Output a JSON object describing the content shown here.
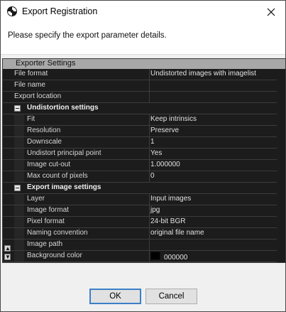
{
  "window": {
    "title": "Export Registration"
  },
  "prompt": "Please specify the export parameter details.",
  "grid": {
    "header": "Exporter Settings",
    "top_rows": [
      {
        "label": "File format",
        "value": "Undistorted images with imagelist"
      },
      {
        "label": "File name",
        "value": ""
      },
      {
        "label": "Export location",
        "value": ""
      }
    ],
    "sections": [
      {
        "title": "Undistortion settings",
        "rows": [
          {
            "label": "Fit",
            "value": "Keep intrinsics"
          },
          {
            "label": "Resolution",
            "value": "Preserve"
          },
          {
            "label": "Downscale",
            "value": "1"
          },
          {
            "label": "Undistort principal point",
            "value": "Yes"
          },
          {
            "label": "Image cut-out",
            "value": "1.000000"
          },
          {
            "label": "Max count of pixels",
            "value": "0"
          }
        ]
      },
      {
        "title": "Export image settings",
        "rows": [
          {
            "label": "Layer",
            "value": "Input images"
          },
          {
            "label": "Image format",
            "value": "jpg"
          },
          {
            "label": "Pixel format",
            "value": "24-bit BGR"
          },
          {
            "label": "Naming convention",
            "value": "original file name"
          },
          {
            "label": "Image path",
            "value": ""
          },
          {
            "label": "Background color",
            "value": "000000",
            "swatch": "#000000"
          }
        ]
      }
    ]
  },
  "buttons": {
    "ok": "OK",
    "cancel": "Cancel"
  }
}
